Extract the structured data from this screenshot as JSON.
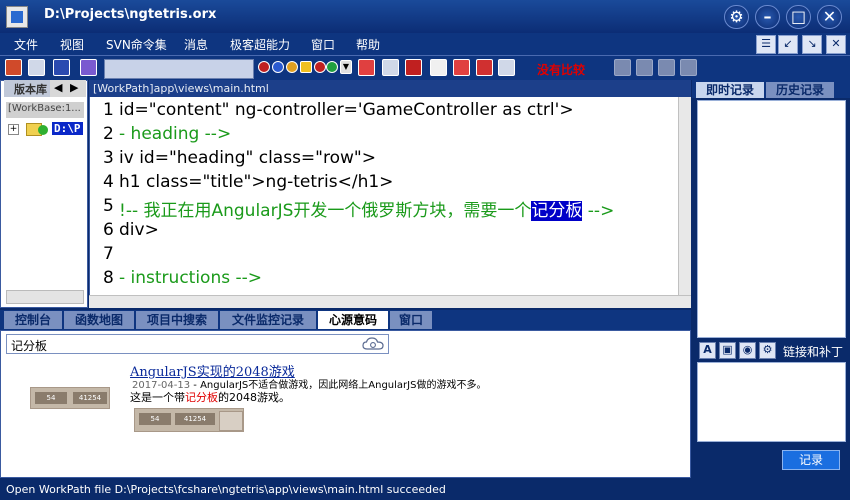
{
  "window": {
    "title": "D:\\Projects\\ngtetris.orx",
    "controls": [
      "gear-icon",
      "minimize-icon",
      "maximize-icon",
      "close-icon"
    ]
  },
  "menu": {
    "items": [
      "文件",
      "视图",
      "SVN命令集",
      "消息",
      "极客超能力",
      "窗口",
      "帮助"
    ]
  },
  "toolbar": {
    "no_compare": "没有比较",
    "search_value": ""
  },
  "left_pane": {
    "tab_label": "版本库",
    "workbase_label": "[WorkBase:1...",
    "tree_root_label": "D:\\P"
  },
  "editor": {
    "path": "[WorkPath]app\\views\\main.html",
    "lines": [
      {
        "num": "1",
        "pre": "id=\"content\" ng-controller='GameController as ctrl'>",
        "comment": "",
        "hl": "",
        "post": ""
      },
      {
        "num": "2",
        "pre": "",
        "comment": "- heading -->",
        "hl": "",
        "post": ""
      },
      {
        "num": "3",
        "pre": "iv id=\"heading\" class=\"row\">",
        "comment": "",
        "hl": "",
        "post": ""
      },
      {
        "num": "4",
        "pre": "h1 class=\"title\">ng-tetris</h1>",
        "comment": "",
        "hl": "",
        "post": ""
      },
      {
        "num": "5",
        "pre": "",
        "comment": "!-- 我正在用AngularJS开发一个俄罗斯方块，需要一个",
        "hl": "记分板",
        "post": " -->"
      },
      {
        "num": "6",
        "pre": "div>",
        "comment": "",
        "hl": "",
        "post": ""
      },
      {
        "num": "7",
        "pre": "",
        "comment": "",
        "hl": "",
        "post": ""
      },
      {
        "num": "8",
        "pre": "",
        "comment": "- instructions -->",
        "hl": "",
        "post": ""
      }
    ]
  },
  "right_pane": {
    "tab_instant": "即时记录",
    "tab_history": "历史记录",
    "link_patch": "链接和补丁",
    "record_button": "记录"
  },
  "bottom_pane": {
    "tabs": [
      "控制台",
      "函数地图",
      "项目中搜索",
      "文件监控记录",
      "心源意码",
      "窗口"
    ],
    "active_tab": "心源意码",
    "search_value": "记分板",
    "result": {
      "title": "AngularJS实现的2048游戏",
      "date": "2017-04-13",
      "meta_text": " - AngularJS不适合做游戏，因此网络上AngularJS做的游戏不多。",
      "snippet_before": "这是一个带",
      "snippet_highlight": "记分板",
      "snippet_after": "的2048游戏。",
      "thumb_scores": [
        "54",
        "41254"
      ]
    }
  },
  "statusbar": {
    "text": "Open WorkPath file D:\\Projects\\fcshare\\ngtetris\\app\\views\\main.html succeeded"
  },
  "colors": {
    "frame": "#0a2a6a",
    "comment_green": "#1a9a1a",
    "highlight_blue": "#0000c8",
    "alert_red": "#e00000"
  }
}
